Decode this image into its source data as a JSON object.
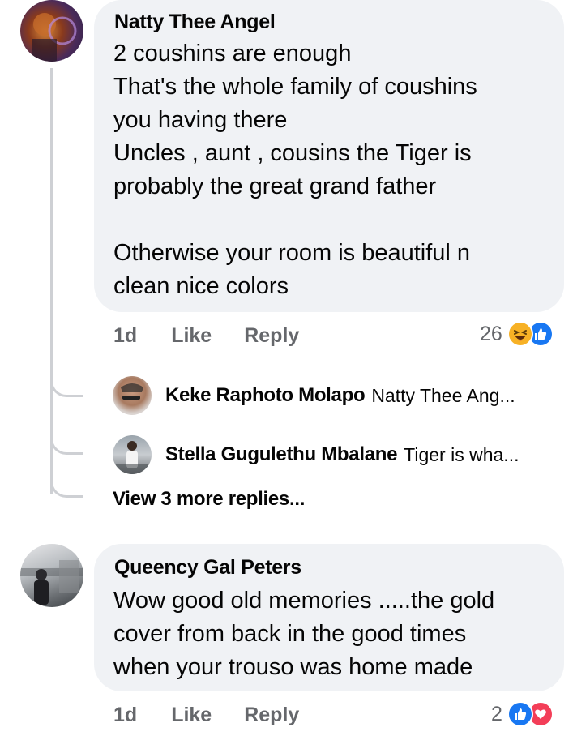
{
  "comments": [
    {
      "author": "Natty Thee Angel",
      "text": "2 coushins are enough\nThat's the whole family of coushins\nyou having there\nUncles , aunt , cousins the Tiger is\nprobably the great grand father\n\nOtherwise your room is beautiful n\nclean nice colors",
      "timestamp": "1d",
      "like_label": "Like",
      "reply_label": "Reply",
      "reaction_count": "26",
      "reactions": [
        "haha-icon",
        "like-icon"
      ],
      "replies": [
        {
          "author": "Keke Raphoto Molapo",
          "snippet": "Natty Thee Ang..."
        },
        {
          "author": "Stella Gugulethu Mbalane",
          "snippet": "Tiger is wha..."
        }
      ],
      "view_more": "View 3 more replies..."
    },
    {
      "author": "Queency Gal Peters",
      "text": "Wow good old memories .....the gold\ncover from back in the good times\nwhen your trouso was home made",
      "timestamp": "1d",
      "like_label": "Like",
      "reply_label": "Reply",
      "reaction_count": "2",
      "reactions": [
        "like-icon",
        "love-icon"
      ]
    }
  ],
  "colors": {
    "bubble": "#f0f2f5",
    "secondary_text": "#65676b",
    "like_blue": "#1877f2",
    "love_red": "#f33e58",
    "haha_yellow": "#f7b125",
    "thread_line": "#ced0d4"
  }
}
